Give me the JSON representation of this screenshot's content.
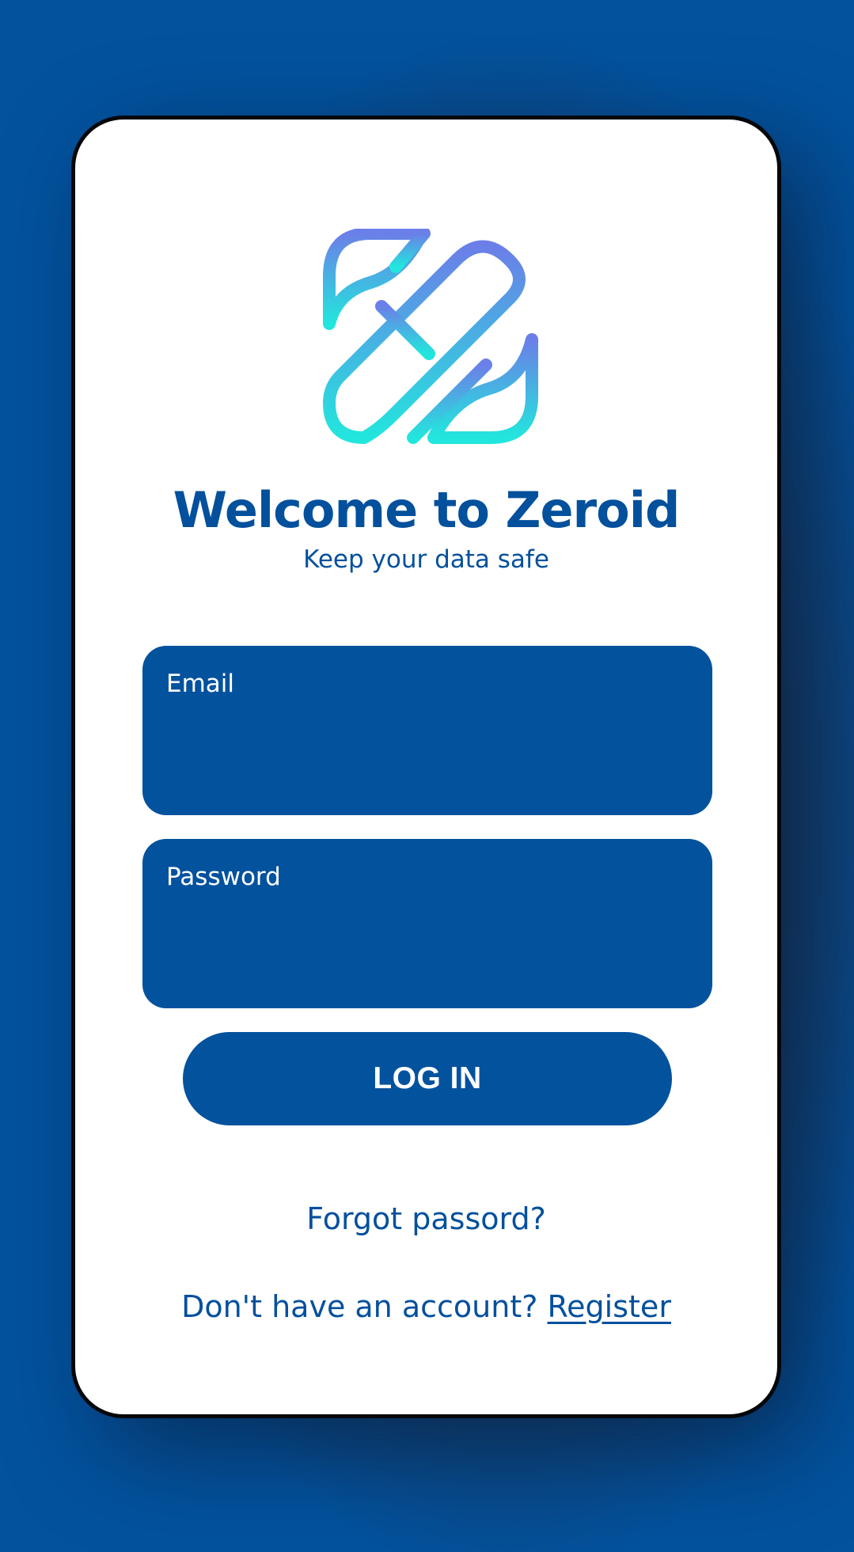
{
  "app": {
    "title": "Welcome to Zeroid",
    "subtitle": "Keep your data safe",
    "logo_icon": "zeroid-logo-icon"
  },
  "form": {
    "email": {
      "label": "Email",
      "value": "",
      "placeholder": ""
    },
    "password": {
      "label": "Password",
      "value": "",
      "placeholder": ""
    },
    "login_label": "LOG IN"
  },
  "links": {
    "forgot_password": "Forgot passord?",
    "no_account_prompt": "Don't have an account?",
    "register": "Register"
  },
  "colors": {
    "primary": "#03529e",
    "background": "#03529e",
    "card": "#ffffff",
    "logo_gradient_top": "#6b7fe8",
    "logo_gradient_bottom": "#22e6dd"
  }
}
